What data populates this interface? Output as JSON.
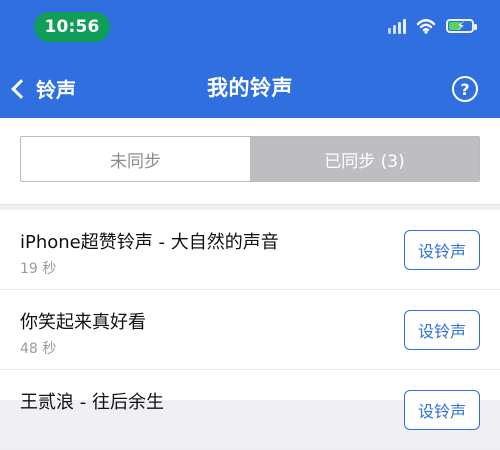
{
  "status_bar": {
    "time": "10:56",
    "icons": [
      "signal-icon",
      "wifi-icon",
      "battery-charging-icon"
    ],
    "battery_level": 0.55,
    "colors": {
      "time_pill": "#0f9d58",
      "battery_fill": "#55d35b"
    }
  },
  "nav": {
    "back_label": "铃声",
    "title": "我的铃声",
    "help_symbol": "?",
    "colors": {
      "header_bg": "#2f6fe0",
      "text": "#ffffff"
    }
  },
  "segmented": {
    "left_label": "未同步",
    "right_label": "已同步 (3)",
    "selected": "right"
  },
  "ringtones": [
    {
      "name": "iPhone超赞铃声 - 大自然的声音",
      "duration": "19 秒",
      "button": "设铃声"
    },
    {
      "name": "你笑起来真好看",
      "duration": "48 秒",
      "button": "设铃声"
    },
    {
      "name": "王贰浪 - 往后余生",
      "duration": "",
      "button": "设铃声"
    }
  ]
}
